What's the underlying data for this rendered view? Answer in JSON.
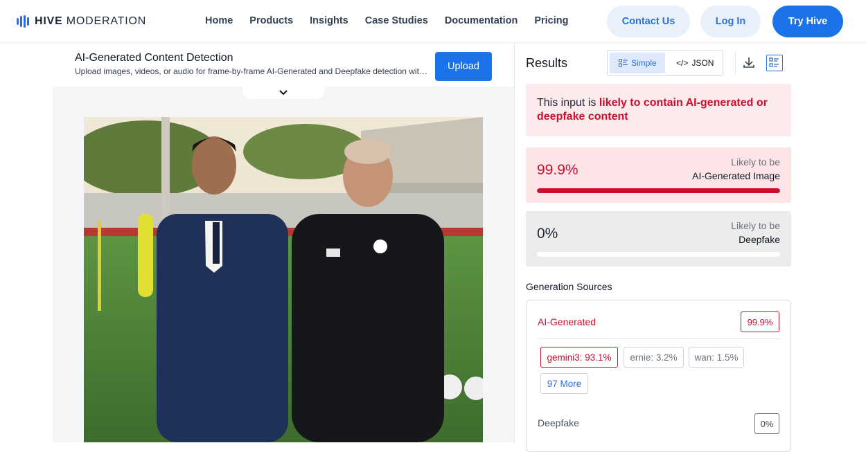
{
  "nav": {
    "brand_bold": "HIVE",
    "brand_light": "MODERATION",
    "links": [
      "Home",
      "Products",
      "Insights",
      "Case Studies",
      "Documentation",
      "Pricing"
    ],
    "contact_label": "Contact Us",
    "login_label": "Log In",
    "try_label": "Try Hive"
  },
  "upload": {
    "title": "AI-Generated Content Detection",
    "subtitle": "Upload images, videos, or audio for frame-by-frame AI-Generated and Deepfake detection with the Hive Moderation AI-Generated Content detector.",
    "upload_label": "Upload"
  },
  "results": {
    "title": "Results",
    "simple_label": "Simple",
    "json_label": "JSON",
    "verdict_prefix": "This input is ",
    "verdict_highlight": "likely to contain AI-generated or deepfake content",
    "scores": [
      {
        "value_text": "99.9%",
        "value": 99.9,
        "likely_label": "Likely to be",
        "type_label": "AI-Generated Image"
      },
      {
        "value_text": "0%",
        "value": 0,
        "likely_label": "Likely to be",
        "type_label": "Deepfake"
      }
    ],
    "generation_sources_title": "Generation Sources",
    "ai_generated_label": "AI-Generated",
    "ai_generated_value": "99.9%",
    "sources": [
      "gemini3: 93.1%",
      "ernie: 3.2%",
      "wan: 1.5%"
    ],
    "more_label": "97 More",
    "deepfake_label": "Deepfake",
    "deepfake_value": "0%"
  },
  "colors": {
    "accent": "#1a73e8",
    "danger": "#c8102e"
  }
}
